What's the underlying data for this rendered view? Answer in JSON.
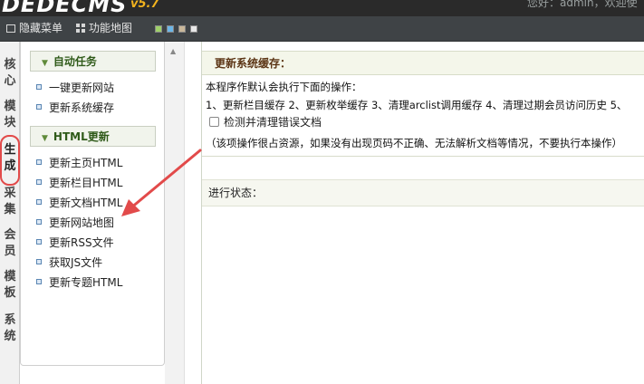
{
  "header": {
    "logo": "DEDECMS",
    "version": "v5.7",
    "welcome": "您好：admin，欢迎使"
  },
  "toolbar": {
    "hide_menu": "隐藏菜单",
    "function_map": "功能地图",
    "theme_swatches": [
      "#9fd06a",
      "#6cb6e8",
      "#c9b79a",
      "#e8e8e8"
    ]
  },
  "side_tabs": [
    {
      "label": "核心"
    },
    {
      "label": "模块"
    },
    {
      "label": "生成",
      "active": true
    },
    {
      "label": "采集"
    },
    {
      "label": "会员"
    },
    {
      "label": "模板"
    },
    {
      "label": "系统"
    }
  ],
  "menu": {
    "group1": {
      "title": "自动任务",
      "items": [
        "一键更新网站",
        "更新系统缓存"
      ]
    },
    "group2": {
      "title": "HTML更新",
      "items": [
        "更新主页HTML",
        "更新栏目HTML",
        "更新文档HTML",
        "更新网站地图",
        "更新RSS文件",
        "获取JS文件",
        "更新专题HTML"
      ]
    }
  },
  "main": {
    "title": "更新系统缓存：",
    "intro": "本程序作默认会执行下面的操作：",
    "operations": "1、更新栏目缓存 2、更新枚举缓存 3、清理arclist调用缓存 4、清理过期会员访问历史 5、",
    "checkbox_label": "检测并清理错误文档",
    "checkbox_checked": false,
    "note": "（该项操作很占资源，如果没有出现页码不正确、无法解析文档等情况，不要执行本操作）",
    "status_label": "进行状态："
  },
  "colors": {
    "header_bg": "#2a2a2a",
    "toolbar_bg": "#3f4346",
    "accent_green": "#2f5a19",
    "title_brown": "#5b3414",
    "annotation_red": "#e24a4a"
  }
}
